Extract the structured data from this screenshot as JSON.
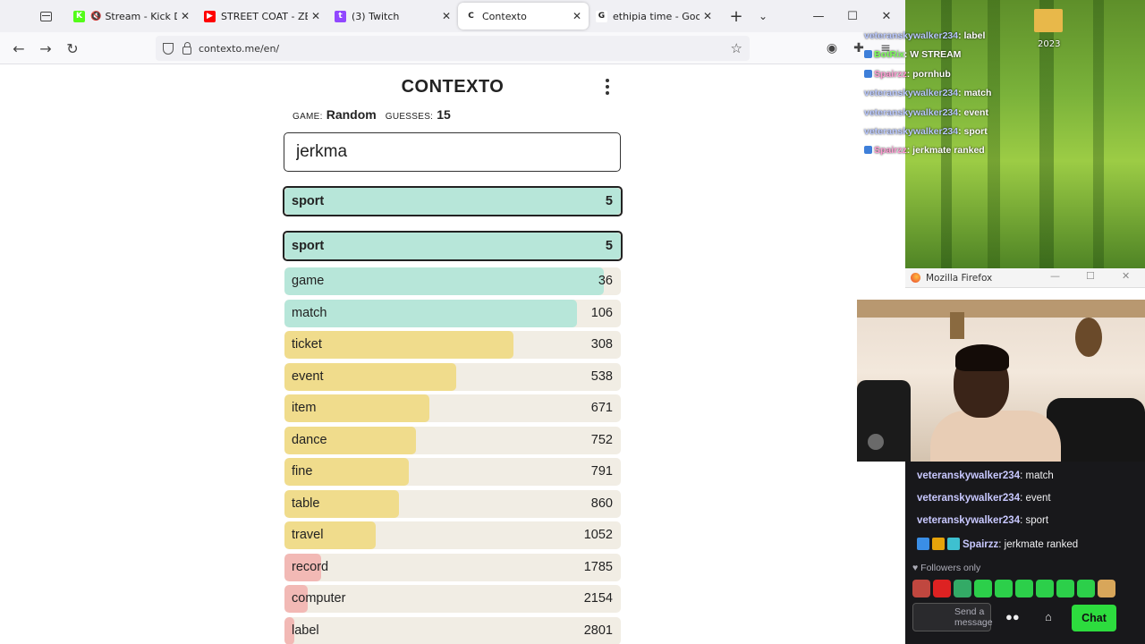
{
  "browser": {
    "tabs": [
      {
        "title": "Stream - Kick Dash",
        "favicon_color": "#53fc18",
        "favicon_letter": "K",
        "muted": true
      },
      {
        "title": "STREET COAT - ZEOTI",
        "favicon_color": "#ff0000",
        "favicon_letter": "▶",
        "muted": false
      },
      {
        "title": "(3) Twitch",
        "favicon_color": "#9147ff",
        "favicon_letter": "t",
        "muted": false
      },
      {
        "title": "Contexto",
        "favicon_color": "#ffffff",
        "favicon_letter": "C",
        "muted": false,
        "active": true
      },
      {
        "title": "ethipia time - Google",
        "favicon_color": "#ffffff",
        "favicon_letter": "G",
        "muted": false
      }
    ],
    "url": "contexto.me/en/"
  },
  "game": {
    "title": "CONTEXTO",
    "game_label": "GAME:",
    "game_value": "Random",
    "guesses_label": "GUESSES:",
    "guesses_value": "15",
    "input_value": "jerkma",
    "last_guess": {
      "word": "sport",
      "rank": "5"
    },
    "guesses": [
      {
        "word": "sport",
        "rank": "5",
        "fill": 1.0,
        "color": "#b7e6d9",
        "highlight": true
      },
      {
        "word": "game",
        "rank": "36",
        "fill": 0.95,
        "color": "#b7e6d9"
      },
      {
        "word": "match",
        "rank": "106",
        "fill": 0.87,
        "color": "#b7e6d9"
      },
      {
        "word": "ticket",
        "rank": "308",
        "fill": 0.68,
        "color": "#f0dc8c"
      },
      {
        "word": "event",
        "rank": "538",
        "fill": 0.51,
        "color": "#f0dc8c"
      },
      {
        "word": "item",
        "rank": "671",
        "fill": 0.43,
        "color": "#f0dc8c"
      },
      {
        "word": "dance",
        "rank": "752",
        "fill": 0.39,
        "color": "#f0dc8c"
      },
      {
        "word": "fine",
        "rank": "791",
        "fill": 0.37,
        "color": "#f0dc8c"
      },
      {
        "word": "table",
        "rank": "860",
        "fill": 0.34,
        "color": "#f0dc8c"
      },
      {
        "word": "travel",
        "rank": "1052",
        "fill": 0.27,
        "color": "#f0dc8c"
      },
      {
        "word": "record",
        "rank": "1785",
        "fill": 0.11,
        "color": "#f2b9b5"
      },
      {
        "word": "computer",
        "rank": "2154",
        "fill": 0.07,
        "color": "#f2b9b5"
      },
      {
        "word": "label",
        "rank": "2801",
        "fill": 0.03,
        "color": "#f2b9b5"
      }
    ]
  },
  "overlay": {
    "folder_label": "2023",
    "chat": [
      {
        "user": "veteranskywalker234",
        "text": ": label",
        "style": "u"
      },
      {
        "user": "BotRix",
        "text": ": W STREAM",
        "style": "g"
      },
      {
        "user": "Spairzz",
        "text": ": pornhub",
        "style": "p"
      },
      {
        "user": "veteranskywalker234",
        "text": ": match",
        "style": "u"
      },
      {
        "user": "veteranskywalker234",
        "text": ": event",
        "style": "u"
      },
      {
        "user": "veteranskywalker234",
        "text": ": sport",
        "style": "u"
      },
      {
        "user": "Spairzz",
        "text": ": jerkmate ranked",
        "style": "p"
      }
    ],
    "ff_window_title": "Mozilla Firefox"
  },
  "twitch": {
    "messages": [
      {
        "user": "veteranskywalker234",
        "text": ": match"
      },
      {
        "user": "veteranskywalker234",
        "text": ": event"
      },
      {
        "user": "veteranskywalker234",
        "text": ": sport"
      },
      {
        "user": "Spairzz",
        "text": ": jerkmate ranked"
      }
    ],
    "followers_only": "Followers only",
    "input_placeholder": "Send a message",
    "chat_button": "Chat"
  }
}
